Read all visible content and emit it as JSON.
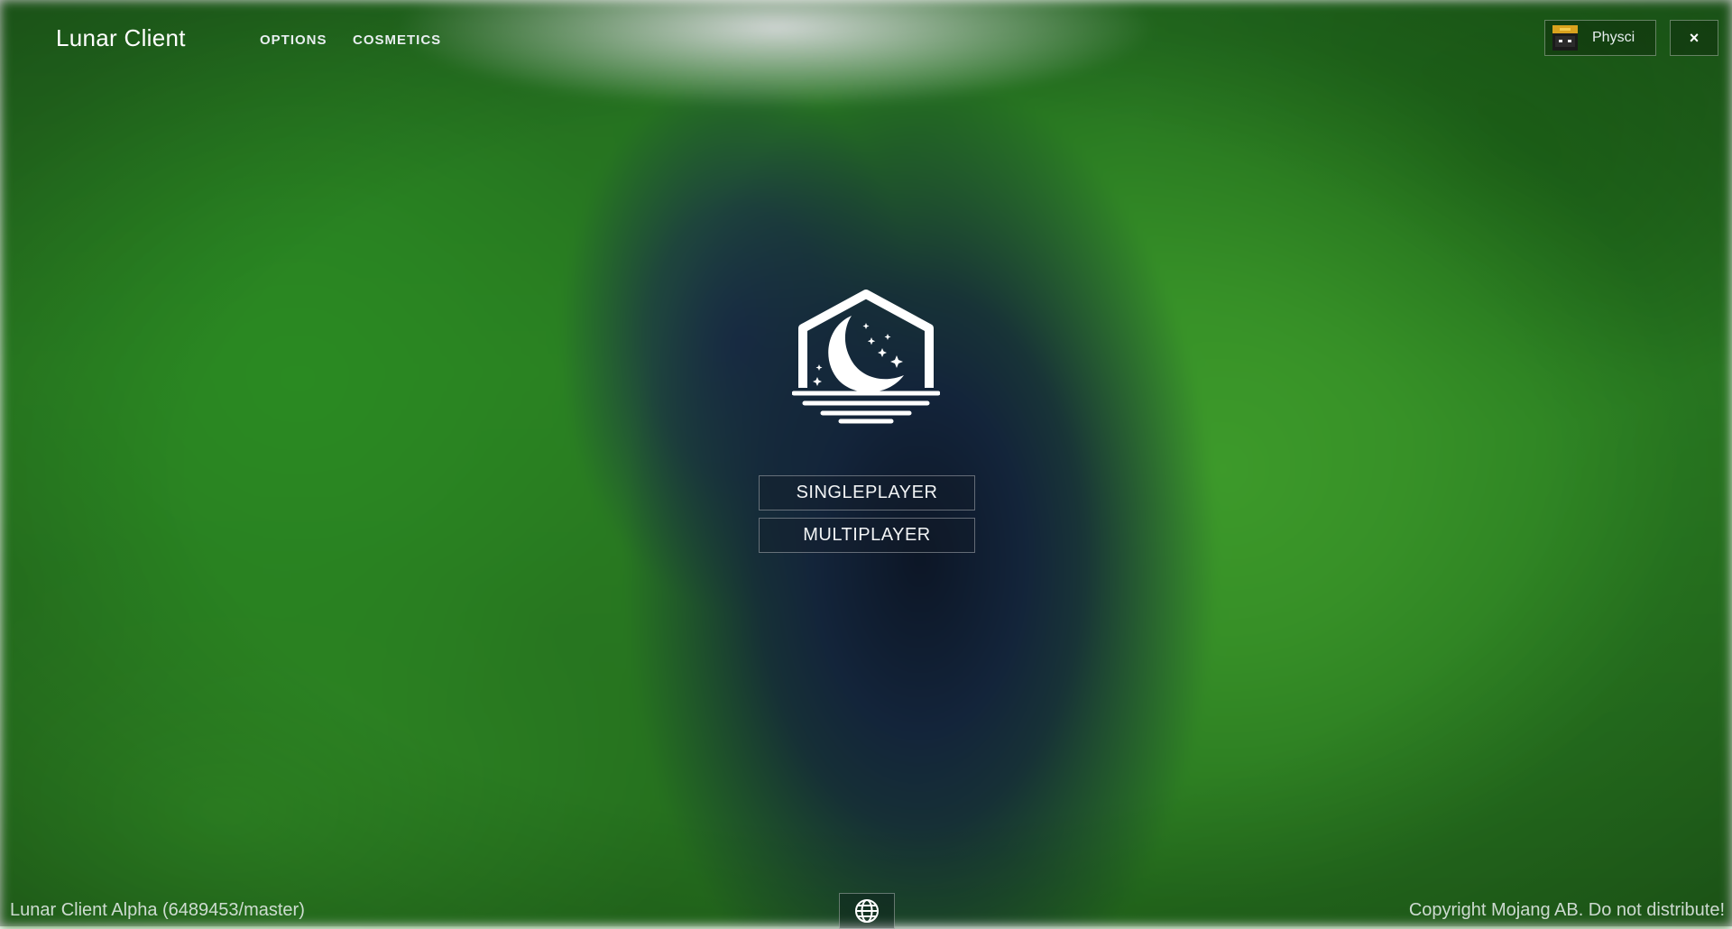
{
  "app": {
    "title": "Lunar Client"
  },
  "nav": {
    "options": "OPTIONS",
    "cosmetics": "COSMETICS"
  },
  "account": {
    "username": "Physci",
    "avatar_icon": "player-head-icon"
  },
  "window": {
    "close_label": "×"
  },
  "main_menu": {
    "logo_icon": "lunar-moon-logo-icon",
    "singleplayer": "SINGLEPLAYER",
    "multiplayer": "MULTIPLAYER"
  },
  "footer": {
    "version": "Lunar Client Alpha (6489453/master)",
    "copyright": "Copyright Mojang AB. Do not distribute!",
    "language_icon": "globe-icon"
  },
  "colors": {
    "text": "#ffffff",
    "button_border": "rgba(255,255,255,0.35)"
  }
}
